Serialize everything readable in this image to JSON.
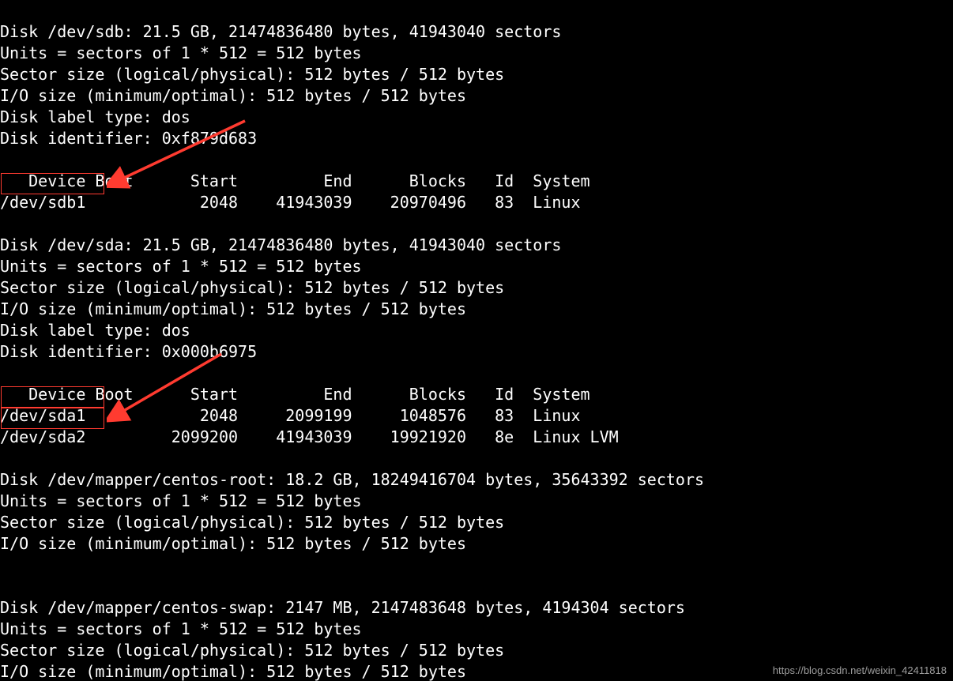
{
  "disks": [
    {
      "header_lines": [
        "Disk /dev/sdb: 21.5 GB, 21474836480 bytes, 41943040 sectors",
        "Units = sectors of 1 * 512 = 512 bytes",
        "Sector size (logical/physical): 512 bytes / 512 bytes",
        "I/O size (minimum/optimal): 512 bytes / 512 bytes",
        "Disk label type: dos",
        "Disk identifier: 0xf879d683"
      ],
      "table_header": "   Device Boot      Start         End      Blocks   Id  System",
      "partitions": [
        "/dev/sdb1            2048    41943039    20970496   83  Linux"
      ]
    },
    {
      "header_lines": [
        "Disk /dev/sda: 21.5 GB, 21474836480 bytes, 41943040 sectors",
        "Units = sectors of 1 * 512 = 512 bytes",
        "Sector size (logical/physical): 512 bytes / 512 bytes",
        "I/O size (minimum/optimal): 512 bytes / 512 bytes",
        "Disk label type: dos",
        "Disk identifier: 0x000b6975"
      ],
      "table_header": "   Device Boot      Start         End      Blocks   Id  System",
      "partitions": [
        "/dev/sda1   *        2048     2099199     1048576   83  Linux",
        "/dev/sda2         2099200    41943039    19921920   8e  Linux LVM"
      ]
    },
    {
      "header_lines": [
        "Disk /dev/mapper/centos-root: 18.2 GB, 18249416704 bytes, 35643392 sectors",
        "Units = sectors of 1 * 512 = 512 bytes",
        "Sector size (logical/physical): 512 bytes / 512 bytes",
        "I/O size (minimum/optimal): 512 bytes / 512 bytes"
      ],
      "table_header": "",
      "partitions": []
    },
    {
      "header_lines": [
        "Disk /dev/mapper/centos-swap: 2147 MB, 2147483648 bytes, 4194304 sectors",
        "Units = sectors of 1 * 512 = 512 bytes",
        "Sector size (logical/physical): 512 bytes / 512 bytes",
        "I/O size (minimum/optimal): 512 bytes / 512 bytes"
      ],
      "table_header": "",
      "partitions": []
    }
  ],
  "annotations": {
    "boxes": [
      {
        "name": "highlight-sdb1",
        "target": "/dev/sdb1"
      },
      {
        "name": "highlight-sda1",
        "target": "/dev/sda1"
      },
      {
        "name": "highlight-sda2",
        "target": "/dev/sda2"
      }
    ],
    "arrows": [
      {
        "name": "arrow-to-sdb1",
        "points_to": "/dev/sdb1"
      },
      {
        "name": "arrow-to-sda1-sda2",
        "points_to": "/dev/sda1,/dev/sda2"
      }
    ],
    "arrow_color": "#ff3b30",
    "box_color": "#ff3b30"
  },
  "watermark": "https://blog.csdn.net/weixin_42411818"
}
